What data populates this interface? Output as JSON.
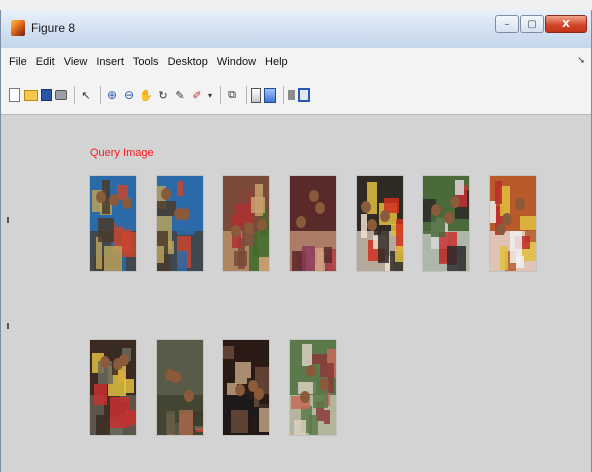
{
  "window": {
    "title": "Figure 8",
    "controls": {
      "minimize": "–",
      "maximize": "▢",
      "close": "X"
    }
  },
  "menu": {
    "items": [
      "File",
      "Edit",
      "View",
      "Insert",
      "Tools",
      "Desktop",
      "Window",
      "Help"
    ],
    "overflow_icon": "chevron-right-icon"
  },
  "toolbar": {
    "icons": [
      "new-figure-icon",
      "open-file-icon",
      "save-icon",
      "print-icon",
      "edit-plot-arrow-icon",
      "zoom-in-icon",
      "zoom-out-icon",
      "pan-hand-icon",
      "rotate-3d-icon",
      "data-cursor-icon",
      "brush-icon",
      "link-plot-icon",
      "insert-colorbar-icon",
      "insert-legend-icon",
      "hide-plot-tools-icon",
      "show-plot-tools-icon"
    ]
  },
  "figure": {
    "query_label": "Query Image",
    "query_label_color": "#ff1a1a",
    "background": "#d3d3d3",
    "images": [
      {
        "name": "query-image",
        "palette": [
          "#2a6aa8",
          "#b8a15a",
          "#c8452f",
          "#4a3b2a"
        ]
      },
      {
        "name": "result-image-1",
        "palette": [
          "#2a6aa8",
          "#b8a15a",
          "#c8452f",
          "#4a3b2a"
        ]
      },
      {
        "name": "result-image-2",
        "palette": [
          "#7a4a3a",
          "#3f6b2d",
          "#b03030",
          "#c8a070"
        ]
      },
      {
        "name": "result-image-3",
        "palette": [
          "#5a2a2a",
          "#8a3a5a",
          "#b04040",
          "#d0a080"
        ]
      },
      {
        "name": "result-image-4",
        "palette": [
          "#2f2a24",
          "#e0c040",
          "#d03020",
          "#f0e0d0"
        ]
      },
      {
        "name": "result-image-5",
        "palette": [
          "#4a6a3a",
          "#2a2a2a",
          "#c83030",
          "#d8d8d8"
        ]
      },
      {
        "name": "result-image-6",
        "palette": [
          "#b85a2a",
          "#e0c040",
          "#c02a2a",
          "#f0f0f0"
        ]
      },
      {
        "name": "result-image-7",
        "palette": [
          "#3a2a22",
          "#c83030",
          "#e0c040",
          "#6a6a5a"
        ]
      },
      {
        "name": "result-image-8",
        "palette": [
          "#5a5a48",
          "#9a6a4a",
          "#c04040",
          "#3a3a2a"
        ]
      },
      {
        "name": "result-image-9",
        "palette": [
          "#2a1a14",
          "#6a4a3a",
          "#c0a080",
          "#1a1a1a"
        ]
      },
      {
        "name": "result-image-10",
        "palette": [
          "#5a7a4a",
          "#8a3a3a",
          "#c86a5a",
          "#d8d0c0"
        ]
      }
    ]
  }
}
